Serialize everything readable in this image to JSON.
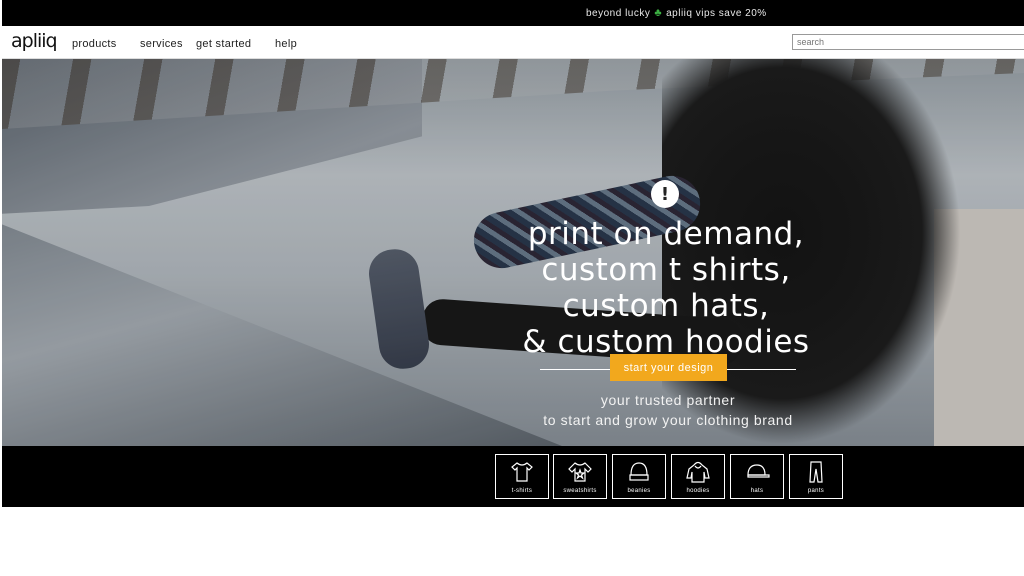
{
  "promo": {
    "text_before": "beyond lucky",
    "clover_icon": "four-leaf-clover-icon",
    "text_after": "apliiq vips save 20%"
  },
  "nav": {
    "logo": "apliiq",
    "links": [
      "products",
      "services",
      "get started",
      "help"
    ],
    "search_placeholder": "search"
  },
  "hero": {
    "alert_icon": "exclamation-circle-icon",
    "headline": [
      "print on demand,",
      "custom t shirts,",
      "custom hats,",
      "& custom hoodies"
    ],
    "cta": "start your design",
    "tagline": [
      "your trusted partner",
      "to start and grow your clothing brand"
    ]
  },
  "categories": [
    {
      "label": "t-shirts",
      "icon": "tshirt-icon"
    },
    {
      "label": "sweatshirts",
      "icon": "sweatshirt-icon"
    },
    {
      "label": "beanies",
      "icon": "beanie-icon"
    },
    {
      "label": "hoodies",
      "icon": "hoodie-icon"
    },
    {
      "label": "hats",
      "icon": "hat-icon"
    },
    {
      "label": "pants",
      "icon": "pants-icon"
    }
  ],
  "colors": {
    "cta": "#f2a81d",
    "clover": "#3cb043",
    "bars": "#000000"
  }
}
